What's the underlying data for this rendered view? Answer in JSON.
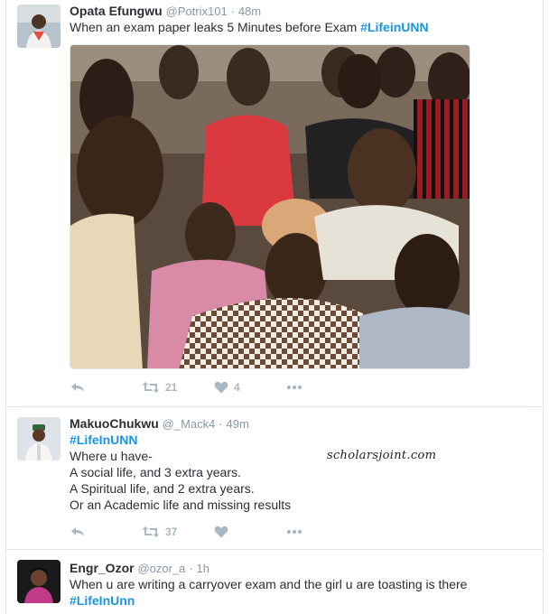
{
  "tweets": [
    {
      "fullname": "Opata Efungwu",
      "username": "@Potrix101",
      "separator": "·",
      "time": "48m",
      "text_before": "When an exam paper leaks 5 Minutes before Exam ",
      "hashtag": "#LifeinUNN",
      "retweets": "21",
      "likes": "4"
    },
    {
      "fullname": "MakuoChukwu",
      "username": "@_Mack4",
      "separator": "·",
      "time": "49m",
      "hashtag": "#LifeInUNN",
      "lines": [
        "Where u have-",
        "A social life, and 3 extra years.",
        "A Spiritual life, and 2 extra years.",
        "Or an Academic life and missing results"
      ],
      "retweets": "37"
    },
    {
      "fullname": "Engr_Ozor",
      "username": "@ozor_a",
      "separator": "·",
      "time": "1h",
      "text": "When u are writing a carryover exam and the girl u are toasting is there",
      "hashtag": "#LifeInUnn"
    }
  ],
  "watermark": "scholarsjoint.com",
  "icons": [
    "reply-icon",
    "retweet-icon",
    "heart-icon",
    "more-icon"
  ],
  "colors": {
    "hashtag": "#1b95e0",
    "meta": "#8899a6",
    "action": "#aab8c2",
    "text": "#292f33"
  }
}
